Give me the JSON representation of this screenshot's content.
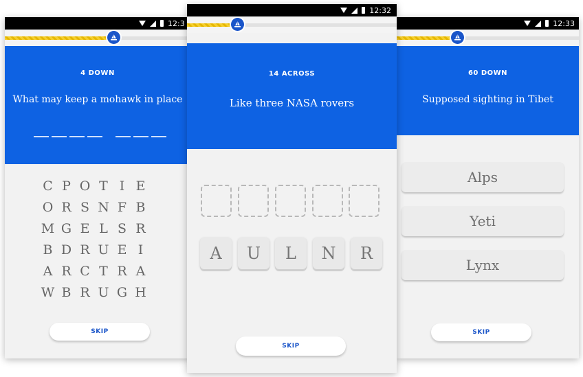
{
  "status_bar": {
    "time": "12:32",
    "time_left": "12:3",
    "time_right": "12:33"
  },
  "colors": {
    "clue_blue": "#0e62e3",
    "progress_yellow": "#f6cf2b",
    "marker_blue": "#1a55c9"
  },
  "icons": [
    "wifi-icon",
    "signal-icon",
    "battery-icon",
    "sailboat-icon"
  ],
  "screens": {
    "left": {
      "progress": 0.57,
      "clue_number": "4 DOWN",
      "clue_text": "What may keep a mohawk in place",
      "letter_grid": [
        [
          "C",
          "P",
          "O",
          "T",
          "I",
          "E"
        ],
        [
          "O",
          "R",
          "S",
          "N",
          "F",
          "B"
        ],
        [
          "M",
          "G",
          "E",
          "L",
          "S",
          "R"
        ],
        [
          "B",
          "D",
          "R",
          "U",
          "E",
          "I"
        ],
        [
          "A",
          "R",
          "C",
          "T",
          "R",
          "A"
        ],
        [
          "W",
          "B",
          "R",
          "U",
          "G",
          "H"
        ]
      ],
      "skip_label": "SKIP"
    },
    "center": {
      "progress": 0.24,
      "clue_number": "14 ACROSS",
      "clue_text": "Like three NASA rovers",
      "tiles": [
        "A",
        "U",
        "L",
        "N",
        "R"
      ],
      "skip_label": "SKIP"
    },
    "right": {
      "progress": 0.33,
      "clue_number": "60 DOWN",
      "clue_text": "Supposed sighting in Tibet",
      "options": [
        "Alps",
        "Yeti",
        "Lynx"
      ],
      "skip_label": "SKIP"
    }
  }
}
